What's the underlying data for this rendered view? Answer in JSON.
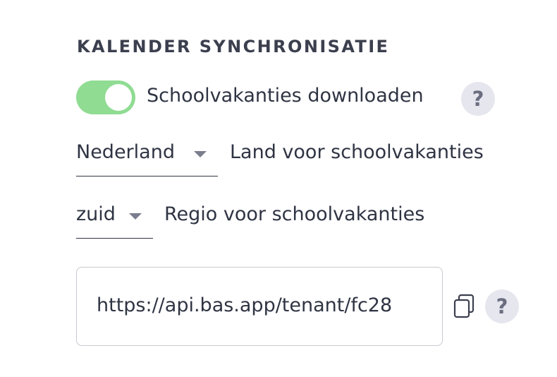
{
  "section": {
    "title": "KALENDER SYNCHRONISATIE"
  },
  "toggle": {
    "label": "Schoolvakanties downloaden",
    "checked": true,
    "color": "#8fdc92",
    "help_glyph": "?"
  },
  "country_select": {
    "value": "Nederland",
    "label": "Land voor schoolvakanties"
  },
  "region_select": {
    "value": "zuid",
    "label": "Regio voor schoolvakanties"
  },
  "calendar_url": {
    "value": "https://api.bas.app/tenant/fc28",
    "copy_icon": "copy-icon",
    "help_glyph": "?"
  }
}
